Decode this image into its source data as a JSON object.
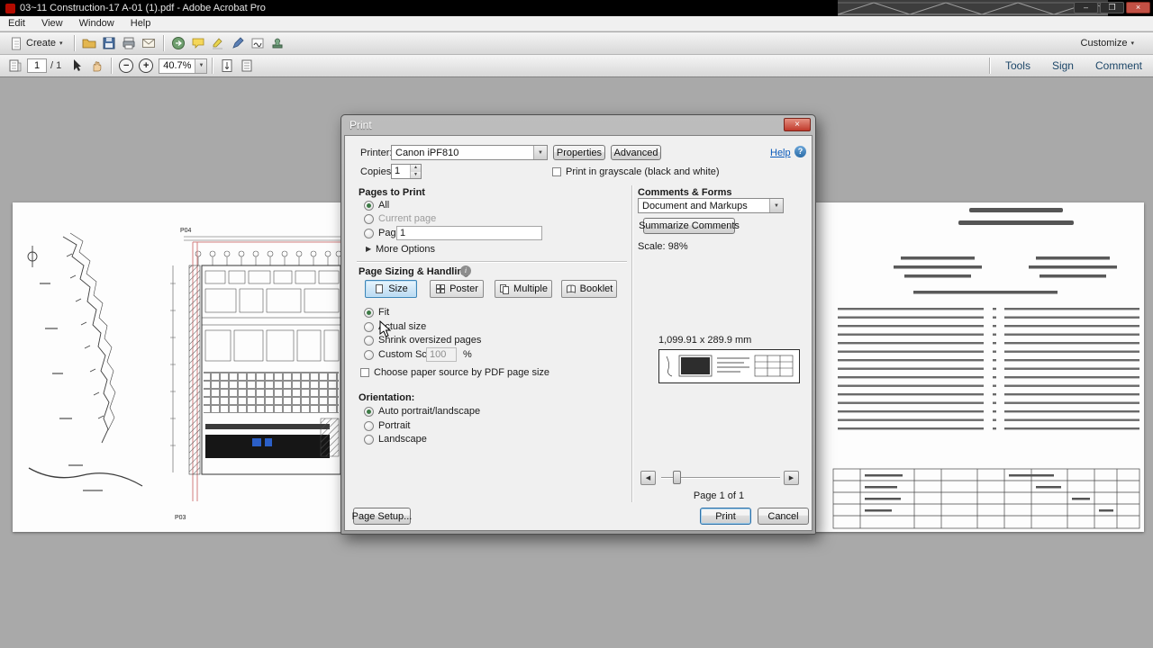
{
  "window": {
    "title": "03~11 Construction-17 A-01 (1).pdf - Adobe Acrobat Pro"
  },
  "menubar": {
    "items": [
      "Edit",
      "View",
      "Window",
      "Help"
    ]
  },
  "toolbar": {
    "create": "Create",
    "customize": "Customize"
  },
  "navbar": {
    "page_value": "1",
    "page_total": "/ 1",
    "zoom_value": "40.7%",
    "tools": "Tools",
    "sign": "Sign",
    "comment": "Comment"
  },
  "document": {
    "label_p04": "P04",
    "label_p03": "P03"
  },
  "dialog": {
    "title": "Print",
    "printer": {
      "label": "Printer:",
      "value": "Canon iPF810",
      "properties": "Properties",
      "advanced": "Advanced",
      "help": "Help"
    },
    "copies": {
      "label": "Copies:",
      "value": "1",
      "grayscale": "Print in grayscale (black and white)"
    },
    "pages_to_print": {
      "heading": "Pages to Print",
      "all": "All",
      "current": "Current page",
      "pages": "Pages",
      "pages_value": "1",
      "more_options": "More Options"
    },
    "sizing": {
      "heading": "Page Sizing & Handling",
      "size": "Size",
      "poster": "Poster",
      "multiple": "Multiple",
      "booklet": "Booklet",
      "fit": "Fit",
      "actual": "Actual size",
      "shrink": "Shrink oversized pages",
      "custom": "Custom Scale:",
      "custom_value": "100",
      "percent": "%",
      "paper_source": "Choose paper source by PDF page size"
    },
    "orientation": {
      "heading": "Orientation:",
      "auto": "Auto portrait/landscape",
      "portrait": "Portrait",
      "landscape": "Landscape"
    },
    "comments": {
      "heading": "Comments & Forms",
      "value": "Document and Markups",
      "summarize": "Summarize Comments",
      "scale": "Scale: 98%"
    },
    "preview": {
      "dimensions": "1,099.91 x 289.9 mm",
      "page_info": "Page 1 of 1"
    },
    "actions": {
      "page_setup": "Page Setup...",
      "print": "Print",
      "cancel": "Cancel"
    }
  }
}
